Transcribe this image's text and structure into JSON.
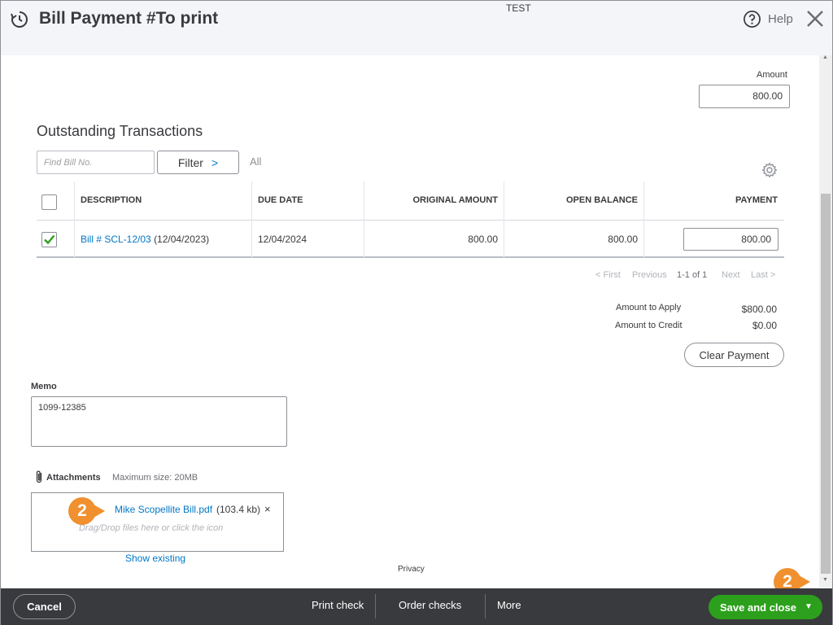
{
  "header": {
    "title": "Bill Payment #To print",
    "company": "TEST",
    "help_label": "Help"
  },
  "amount": {
    "label": "Amount",
    "value": "800.00"
  },
  "outstanding": {
    "title": "Outstanding Transactions",
    "find_placeholder": "Find Bill No.",
    "filter_label": "Filter",
    "filter_chevron": ">",
    "all_label": "All",
    "columns": [
      "DESCRIPTION",
      "DUE DATE",
      "ORIGINAL AMOUNT",
      "OPEN BALANCE",
      "PAYMENT"
    ],
    "rows": [
      {
        "checked": true,
        "bill_link": "Bill # SCL-12/03",
        "bill_date": "(12/04/2023)",
        "due_date": "12/04/2024",
        "original_amount": "800.00",
        "open_balance": "800.00",
        "payment": "800.00"
      }
    ],
    "pager": {
      "first": "< First",
      "previous": "Previous",
      "range": "1-1 of 1",
      "next": "Next",
      "last": "Last >"
    }
  },
  "summary": {
    "apply_label": "Amount to Apply",
    "apply_value": "$800.00",
    "credit_label": "Amount to Credit",
    "credit_value": "$0.00",
    "clear_label": "Clear Payment"
  },
  "memo": {
    "label": "Memo",
    "value": "1099-12385"
  },
  "attachments": {
    "label": "Attachments",
    "max_size": "Maximum size: 20MB",
    "file_name": "Mike Scopellite Bill.pdf",
    "file_size": "(103.4 kb)",
    "remove_glyph": "×",
    "drop_hint": "Drag/Drop files here or click the icon",
    "show_existing": "Show existing"
  },
  "privacy": "Privacy",
  "callouts": [
    "2",
    "2"
  ],
  "footer": {
    "cancel": "Cancel",
    "print_check": "Print check",
    "order_checks": "Order checks",
    "more": "More",
    "save_close": "Save and close"
  },
  "colors": {
    "link": "#0077c5",
    "save_green": "#2ca01c",
    "callout_orange": "#f0902f",
    "footer_bg": "#393a3d"
  }
}
